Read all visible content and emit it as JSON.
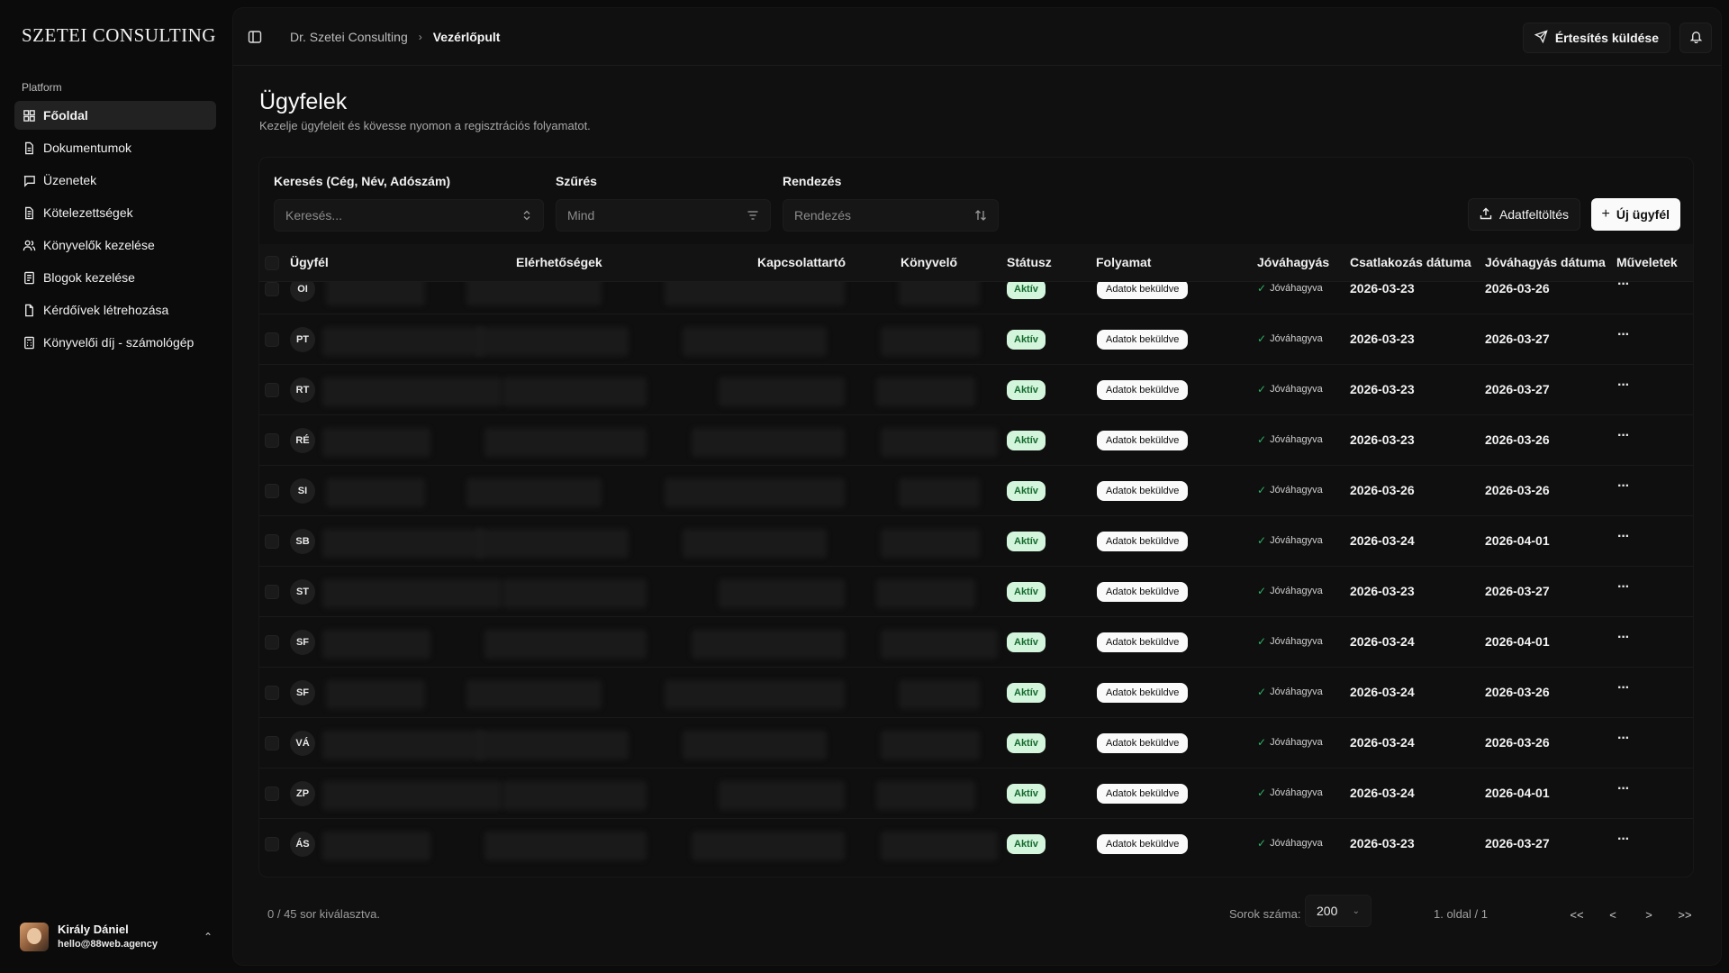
{
  "sidebar": {
    "logo": "SZETEI CONSULTING",
    "group_label": "Platform",
    "items": [
      {
        "label": "Főoldal",
        "icon": "grid-icon"
      },
      {
        "label": "Dokumentumok",
        "icon": "file-icon"
      },
      {
        "label": "Üzenetek",
        "icon": "message-icon"
      },
      {
        "label": "Kötelezettségek",
        "icon": "document-icon"
      },
      {
        "label": "Könyvelők kezelése",
        "icon": "users-icon"
      },
      {
        "label": "Blogok kezelése",
        "icon": "document-icon"
      },
      {
        "label": "Kérdőívek létrehozása",
        "icon": "file-icon"
      },
      {
        "label": "Könyvelői díj - számológép",
        "icon": "calculator-icon"
      }
    ],
    "user": {
      "name": "Király Dániel",
      "email": "hello@88web.agency"
    }
  },
  "topbar": {
    "breadcrumb_parent": "Dr. Szetei Consulting",
    "breadcrumb_current": "Vezérlőpult",
    "notify_label": "Értesítés küldése"
  },
  "page": {
    "title": "Ügyfelek",
    "subtitle": "Kezelje ügyfeleit és kövesse nyomon a regisztrációs folyamatot."
  },
  "filters": {
    "search_label": "Keresés (Cég, Név, Adószám)",
    "search_placeholder": "Keresés...",
    "filter_label": "Szűrés",
    "filter_value": "Mind",
    "sort_label": "Rendezés",
    "sort_placeholder": "Rendezés",
    "upload_label": "Adatfeltöltés",
    "new_label": "Új ügyfél"
  },
  "table": {
    "columns": [
      "Ügyfél",
      "Elérhetőségek",
      "Kapcsolattartó",
      "Könyvelő",
      "Státusz",
      "Folyamat",
      "Jóváhagyás",
      "Csatlakozás dátuma",
      "Jóváhagyás dátuma",
      "Műveletek"
    ],
    "rows": [
      {
        "initials": "OI",
        "status": "Aktív",
        "flow": "Adatok beküldve",
        "approval": "Jóváhagyva",
        "joined": "2026-03-23",
        "approved": "2026-03-26"
      },
      {
        "initials": "PT",
        "status": "Aktív",
        "flow": "Adatok beküldve",
        "approval": "Jóváhagyva",
        "joined": "2026-03-23",
        "approved": "2026-03-27"
      },
      {
        "initials": "RT",
        "status": "Aktív",
        "flow": "Adatok beküldve",
        "approval": "Jóváhagyva",
        "joined": "2026-03-23",
        "approved": "2026-03-27"
      },
      {
        "initials": "RÉ",
        "status": "Aktív",
        "flow": "Adatok beküldve",
        "approval": "Jóváhagyva",
        "joined": "2026-03-23",
        "approved": "2026-03-26"
      },
      {
        "initials": "SI",
        "status": "Aktív",
        "flow": "Adatok beküldve",
        "approval": "Jóváhagyva",
        "joined": "2026-03-26",
        "approved": "2026-03-26"
      },
      {
        "initials": "SB",
        "status": "Aktív",
        "flow": "Adatok beküldve",
        "approval": "Jóváhagyva",
        "joined": "2026-03-24",
        "approved": "2026-04-01"
      },
      {
        "initials": "ST",
        "status": "Aktív",
        "flow": "Adatok beküldve",
        "approval": "Jóváhagyva",
        "joined": "2026-03-23",
        "approved": "2026-03-27"
      },
      {
        "initials": "SF",
        "status": "Aktív",
        "flow": "Adatok beküldve",
        "approval": "Jóváhagyva",
        "joined": "2026-03-24",
        "approved": "2026-04-01"
      },
      {
        "initials": "SF",
        "status": "Aktív",
        "flow": "Adatok beküldve",
        "approval": "Jóváhagyva",
        "joined": "2026-03-24",
        "approved": "2026-03-26"
      },
      {
        "initials": "VÁ",
        "status": "Aktív",
        "flow": "Adatok beküldve",
        "approval": "Jóváhagyva",
        "joined": "2026-03-24",
        "approved": "2026-03-26"
      },
      {
        "initials": "ZP",
        "status": "Aktív",
        "flow": "Adatok beküldve",
        "approval": "Jóváhagyva",
        "joined": "2026-03-24",
        "approved": "2026-04-01"
      },
      {
        "initials": "ÁS",
        "status": "Aktív",
        "flow": "Adatok beküldve",
        "approval": "Jóváhagyva",
        "joined": "2026-03-23",
        "approved": "2026-03-27"
      }
    ]
  },
  "footer": {
    "selected": "0 / 45 sor kiválasztva.",
    "rows_label": "Sorok száma:",
    "rows_value": "200",
    "page_info": "1. oldal / 1",
    "first": "<<",
    "prev": "<",
    "next": ">",
    "last": ">>"
  }
}
